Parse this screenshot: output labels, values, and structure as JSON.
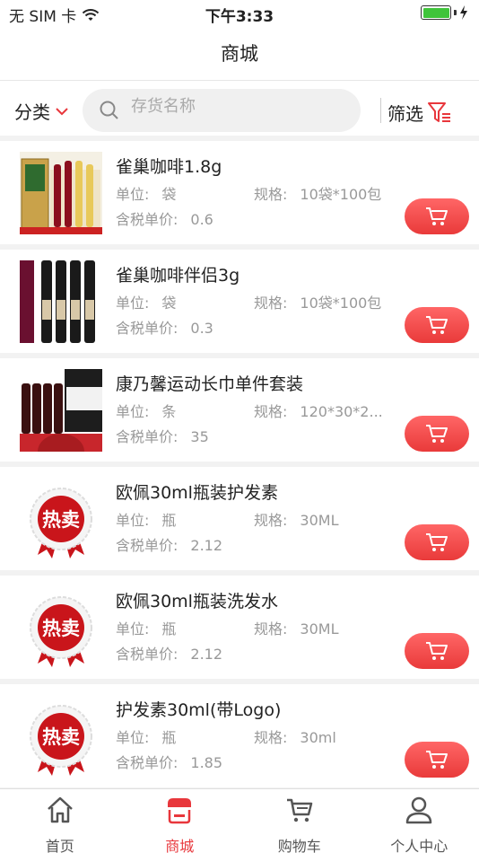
{
  "status": {
    "carrier": "无 SIM 卡",
    "time": "下午3:33",
    "battery_level": 1.0
  },
  "header": {
    "title": "商城"
  },
  "filter": {
    "category_label": "分类",
    "search_placeholder": "存货名称",
    "screen_label": "筛选"
  },
  "labels": {
    "unit": "单位:",
    "spec": "规格:",
    "price": "含税单价:"
  },
  "products": [
    {
      "name": "雀巢咖啡1.8g",
      "unit": "袋",
      "spec": "10袋*100包",
      "price": "0.6",
      "image": "wine-gift-box"
    },
    {
      "name": "雀巢咖啡伴侣3g",
      "unit": "袋",
      "spec": "10袋*100包",
      "price": "0.3",
      "image": "wine-bottles"
    },
    {
      "name": "康乃馨运动长巾单件套装",
      "unit": "条",
      "spec": "120*30*2...",
      "price": "35",
      "image": "wine-gift-set"
    },
    {
      "name": "欧佩30ml瓶装护发素",
      "unit": "瓶",
      "spec": "30ML",
      "price": "2.12",
      "image": "hot-sale-badge",
      "badge": "热卖"
    },
    {
      "name": "欧佩30ml瓶装洗发水",
      "unit": "瓶",
      "spec": "30ML",
      "price": "2.12",
      "image": "hot-sale-badge",
      "badge": "热卖"
    },
    {
      "name": "护发素30ml(带Logo)",
      "unit": "瓶",
      "spec": "30ml",
      "price": "1.85",
      "image": "hot-sale-badge",
      "badge": "热卖"
    }
  ],
  "tabs": [
    {
      "label": "首页",
      "icon": "home-icon",
      "active": false
    },
    {
      "label": "商城",
      "icon": "store-icon",
      "active": true
    },
    {
      "label": "购物车",
      "icon": "cart-icon",
      "active": false
    },
    {
      "label": "个人中心",
      "icon": "person-icon",
      "active": false
    }
  ],
  "colors": {
    "accent": "#e8373c",
    "cart_button": "#ee4444",
    "text_muted": "#999999"
  }
}
